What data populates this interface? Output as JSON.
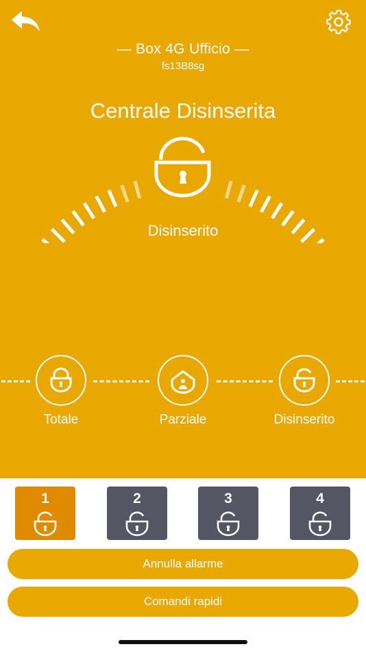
{
  "header": {
    "back_icon": "back-arrow-icon",
    "settings_icon": "gear-icon",
    "device_name": "— Box 4G Ufficio —",
    "device_code": "fs13B8sg"
  },
  "status": {
    "title": "Centrale Disinserita",
    "lock_icon": "unlocked-padlock-icon",
    "state_label": "Disinserito"
  },
  "modes": [
    {
      "label": "Totale",
      "icon": "padlock-icon"
    },
    {
      "label": "Parziale",
      "icon": "house-person-icon"
    },
    {
      "label": "Disinserito",
      "icon": "unlocked-padlock-icon"
    }
  ],
  "areas": [
    {
      "number": "1",
      "icon": "unlocked-padlock-icon",
      "active": true
    },
    {
      "number": "2",
      "icon": "unlocked-padlock-icon",
      "active": false
    },
    {
      "number": "3",
      "icon": "unlocked-padlock-icon",
      "active": false
    },
    {
      "number": "4",
      "icon": "unlocked-padlock-icon",
      "active": false
    }
  ],
  "actions": {
    "cancel_alarm_label": "Annulla allarme",
    "quick_commands_label": "Comandi rapidi"
  },
  "colors": {
    "background": "#E8A800",
    "area_active": "#E08A00",
    "area_inactive": "#545663",
    "foreground": "#FFFFFF"
  }
}
